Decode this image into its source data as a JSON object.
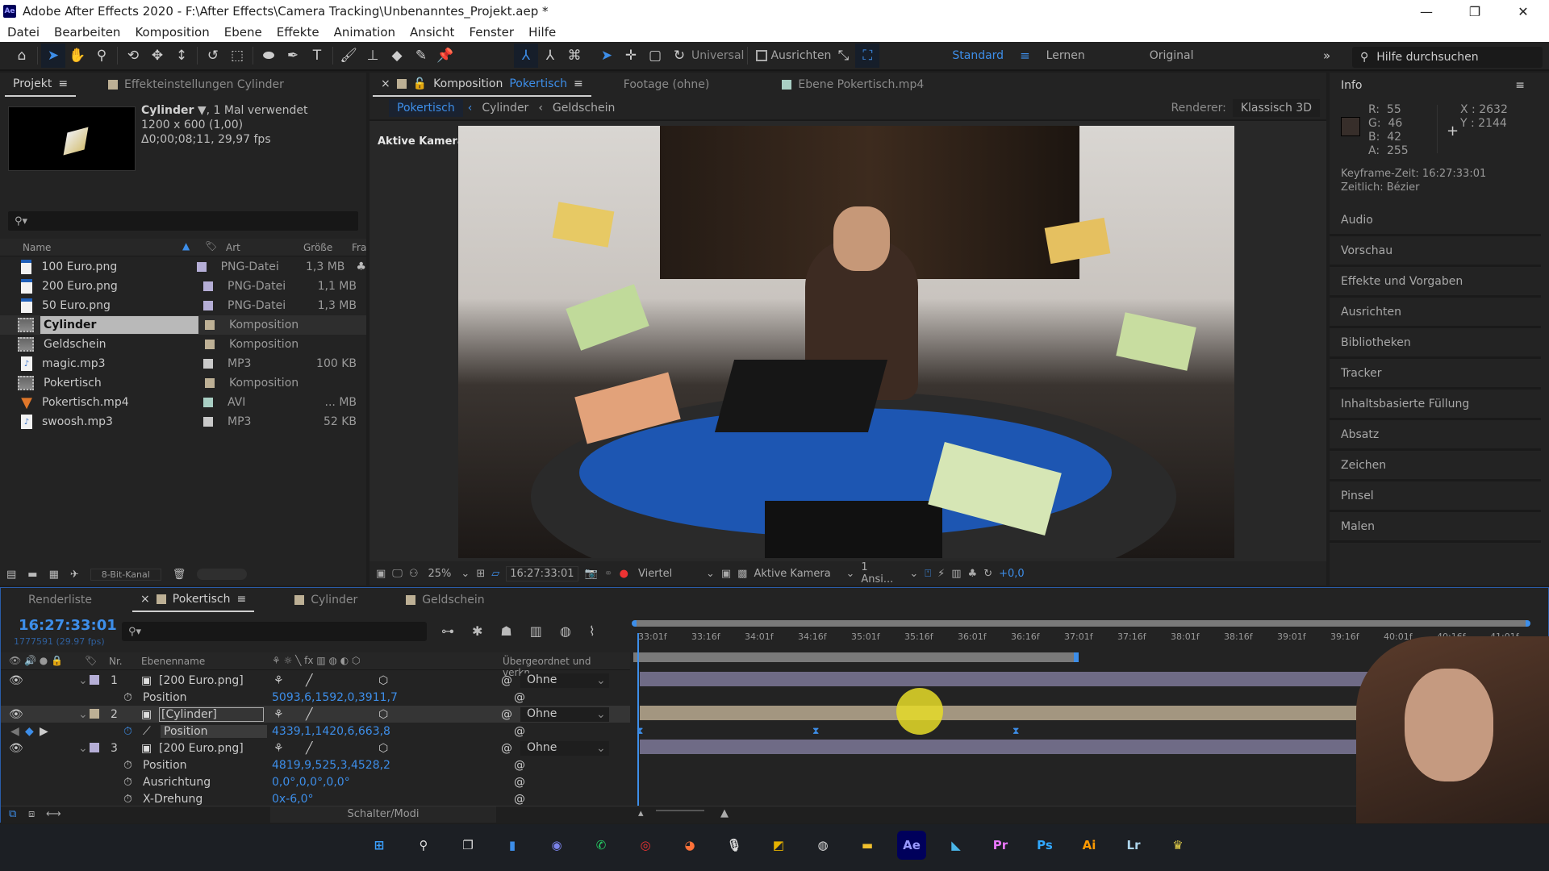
{
  "window": {
    "title": "Adobe After Effects 2020 - F:\\After Effects\\Camera Tracking\\Unbenanntes_Projekt.aep *",
    "app_icon": "Ae",
    "minimize": "—",
    "maximize": "❐",
    "close": "✕"
  },
  "menu": [
    "Datei",
    "Bearbeiten",
    "Komposition",
    "Ebene",
    "Effekte",
    "Animation",
    "Ansicht",
    "Fenster",
    "Hilfe"
  ],
  "toolbar": {
    "universal_label": "Universal",
    "ausrichten_label": "Ausrichten",
    "workspaces": [
      "Standard",
      "Lernen",
      "Original"
    ],
    "active_workspace": "Standard",
    "help_placeholder": "Hilfe durchsuchen"
  },
  "project": {
    "tab_label": "Projekt",
    "effects_tab_label": "Effekteinstellungen Cylinder",
    "preview": {
      "name": "Cylinder",
      "usage": ", 1 Mal verwendet",
      "dimensions": "1200 x 600 (1,00)",
      "duration": "Δ0;00;08;11, 29,97 fps"
    },
    "columns": {
      "name": "Name",
      "type": "Art",
      "size": "Größe",
      "frame": "Fra"
    },
    "items": [
      {
        "name": "100 Euro.png",
        "type": "PNG-Datei",
        "size": "1,3 MB",
        "icon": "png",
        "label": "#b5aed6"
      },
      {
        "name": "200 Euro.png",
        "type": "PNG-Datei",
        "size": "1,1 MB",
        "icon": "png",
        "label": "#b5aed6"
      },
      {
        "name": "50 Euro.png",
        "type": "PNG-Datei",
        "size": "1,3 MB",
        "icon": "png",
        "label": "#b5aed6"
      },
      {
        "name": "Cylinder",
        "type": "Komposition",
        "size": "",
        "icon": "comp",
        "label": "#bdb095",
        "selected": true
      },
      {
        "name": "Geldschein",
        "type": "Komposition",
        "size": "",
        "icon": "comp",
        "label": "#bdb095"
      },
      {
        "name": "magic.mp3",
        "type": "MP3",
        "size": "100 KB",
        "icon": "mp3",
        "label": "#c9c9c9"
      },
      {
        "name": "Pokertisch",
        "type": "Komposition",
        "size": "",
        "icon": "comp",
        "label": "#bdb095"
      },
      {
        "name": "Pokertisch.mp4",
        "type": "AVI",
        "size": "... MB",
        "icon": "avi",
        "label": "#a9cfc4"
      },
      {
        "name": "swoosh.mp3",
        "type": "MP3",
        "size": "52 KB",
        "icon": "mp3",
        "label": "#c9c9c9"
      }
    ],
    "bit_depth": "8-Bit-Kanal"
  },
  "composition": {
    "tab_prefix": "Komposition",
    "tab_name": "Pokertisch",
    "footage_tab": "Footage (ohne)",
    "layer_tab": "Ebene Pokertisch.mp4",
    "breadcrumbs": [
      "Pokertisch",
      "Cylinder",
      "Geldschein"
    ],
    "renderer_label": "Renderer:",
    "renderer_value": "Klassisch 3D",
    "camera_label": "Aktive Kamera",
    "footer": {
      "zoom": "25%",
      "timecode": "16:27:33:01",
      "resolution": "Viertel",
      "camera": "Aktive Kamera",
      "views": "1 Ansi...",
      "exposure": "+0,0"
    }
  },
  "info": {
    "title": "Info",
    "r": "55",
    "g": "46",
    "b": "42",
    "a": "255",
    "x": "2632",
    "y": "2144",
    "swatch": "#372e2a",
    "keyframe_time": "Keyframe-Zeit: 16:27:33:01",
    "temporal": "Zeitlich: Bézier",
    "panels": [
      "Audio",
      "Vorschau",
      "Effekte und Vorgaben",
      "Ausrichten",
      "Bibliotheken",
      "Tracker",
      "Inhaltsbasierte Füllung",
      "Absatz",
      "Zeichen",
      "Pinsel",
      "Malen"
    ]
  },
  "timeline": {
    "tabs": [
      {
        "label": "Renderliste"
      },
      {
        "label": "Pokertisch",
        "active": true
      },
      {
        "label": "Cylinder"
      },
      {
        "label": "Geldschein"
      }
    ],
    "timecode": "16:27:33:01",
    "frames": "1777591 (29.97 fps)",
    "headers": {
      "nr": "Nr.",
      "name": "Ebenenname",
      "parent": "Übergeordnet und verkn..."
    },
    "ruler": [
      "33:01f",
      "33:16f",
      "34:01f",
      "34:16f",
      "35:01f",
      "35:16f",
      "36:01f",
      "36:16f",
      "37:01f",
      "37:16f",
      "38:01f",
      "38:16f",
      "39:01f",
      "39:16f",
      "40:01f",
      "40:16f",
      "41:01f"
    ],
    "layers": [
      {
        "nr": "1",
        "name": "[200 Euro.png]",
        "parent": "Ohne",
        "label": "#b5aed6",
        "props": [
          {
            "name": "Position",
            "value": "5093,6,1592,0,3911,7"
          }
        ]
      },
      {
        "nr": "2",
        "name": "[Cylinder]",
        "parent": "Ohne",
        "label": "#bdb095",
        "selected": true,
        "props": [
          {
            "name": "Position",
            "value": "4339,1,1420,6,663,8"
          }
        ]
      },
      {
        "nr": "3",
        "name": "[200 Euro.png]",
        "parent": "Ohne",
        "label": "#b5aed6",
        "props": [
          {
            "name": "Position",
            "value": "4819,9,525,3,4528,2"
          },
          {
            "name": "Ausrichtung",
            "value": "0,0°,0,0°,0,0°"
          },
          {
            "name": "X-Drehung",
            "value": "0x-6,0°"
          }
        ]
      }
    ],
    "footer_label": "Schalter/Modi"
  },
  "taskbar": [
    {
      "name": "windows-start",
      "glyph": "⊞",
      "color": "#3aa0ff"
    },
    {
      "name": "search",
      "glyph": "⚲",
      "color": "#ddd"
    },
    {
      "name": "task-view",
      "glyph": "❐",
      "color": "#ddd"
    },
    {
      "name": "widgets",
      "glyph": "▮",
      "color": "#3d8ee9"
    },
    {
      "name": "teams",
      "glyph": "◉",
      "color": "#7b83eb"
    },
    {
      "name": "whatsapp",
      "glyph": "✆",
      "color": "#25d366"
    },
    {
      "name": "screen-recorder",
      "glyph": "◎",
      "color": "#e33"
    },
    {
      "name": "firefox",
      "glyph": "◕",
      "color": "#ff7139"
    },
    {
      "name": "microphone",
      "glyph": "🎙",
      "color": "#ddd"
    },
    {
      "name": "image-tool",
      "glyph": "◩",
      "color": "#e5b100"
    },
    {
      "name": "obs",
      "glyph": "◍",
      "color": "#ddd"
    },
    {
      "name": "file-explorer",
      "glyph": "▬",
      "color": "#f2c12e"
    },
    {
      "name": "after-effects",
      "glyph": "Ae",
      "color": "#9999ff"
    },
    {
      "name": "vegas",
      "glyph": "◣",
      "color": "#4ab6e8"
    },
    {
      "name": "premiere",
      "glyph": "Pr",
      "color": "#ea77ff"
    },
    {
      "name": "photoshop",
      "glyph": "Ps",
      "color": "#31a8ff"
    },
    {
      "name": "illustrator",
      "glyph": "Ai",
      "color": "#ff9a00"
    },
    {
      "name": "lightroom",
      "glyph": "Lr",
      "color": "#add5ec"
    },
    {
      "name": "app-cat",
      "glyph": "♛",
      "color": "#e5d14a"
    }
  ]
}
